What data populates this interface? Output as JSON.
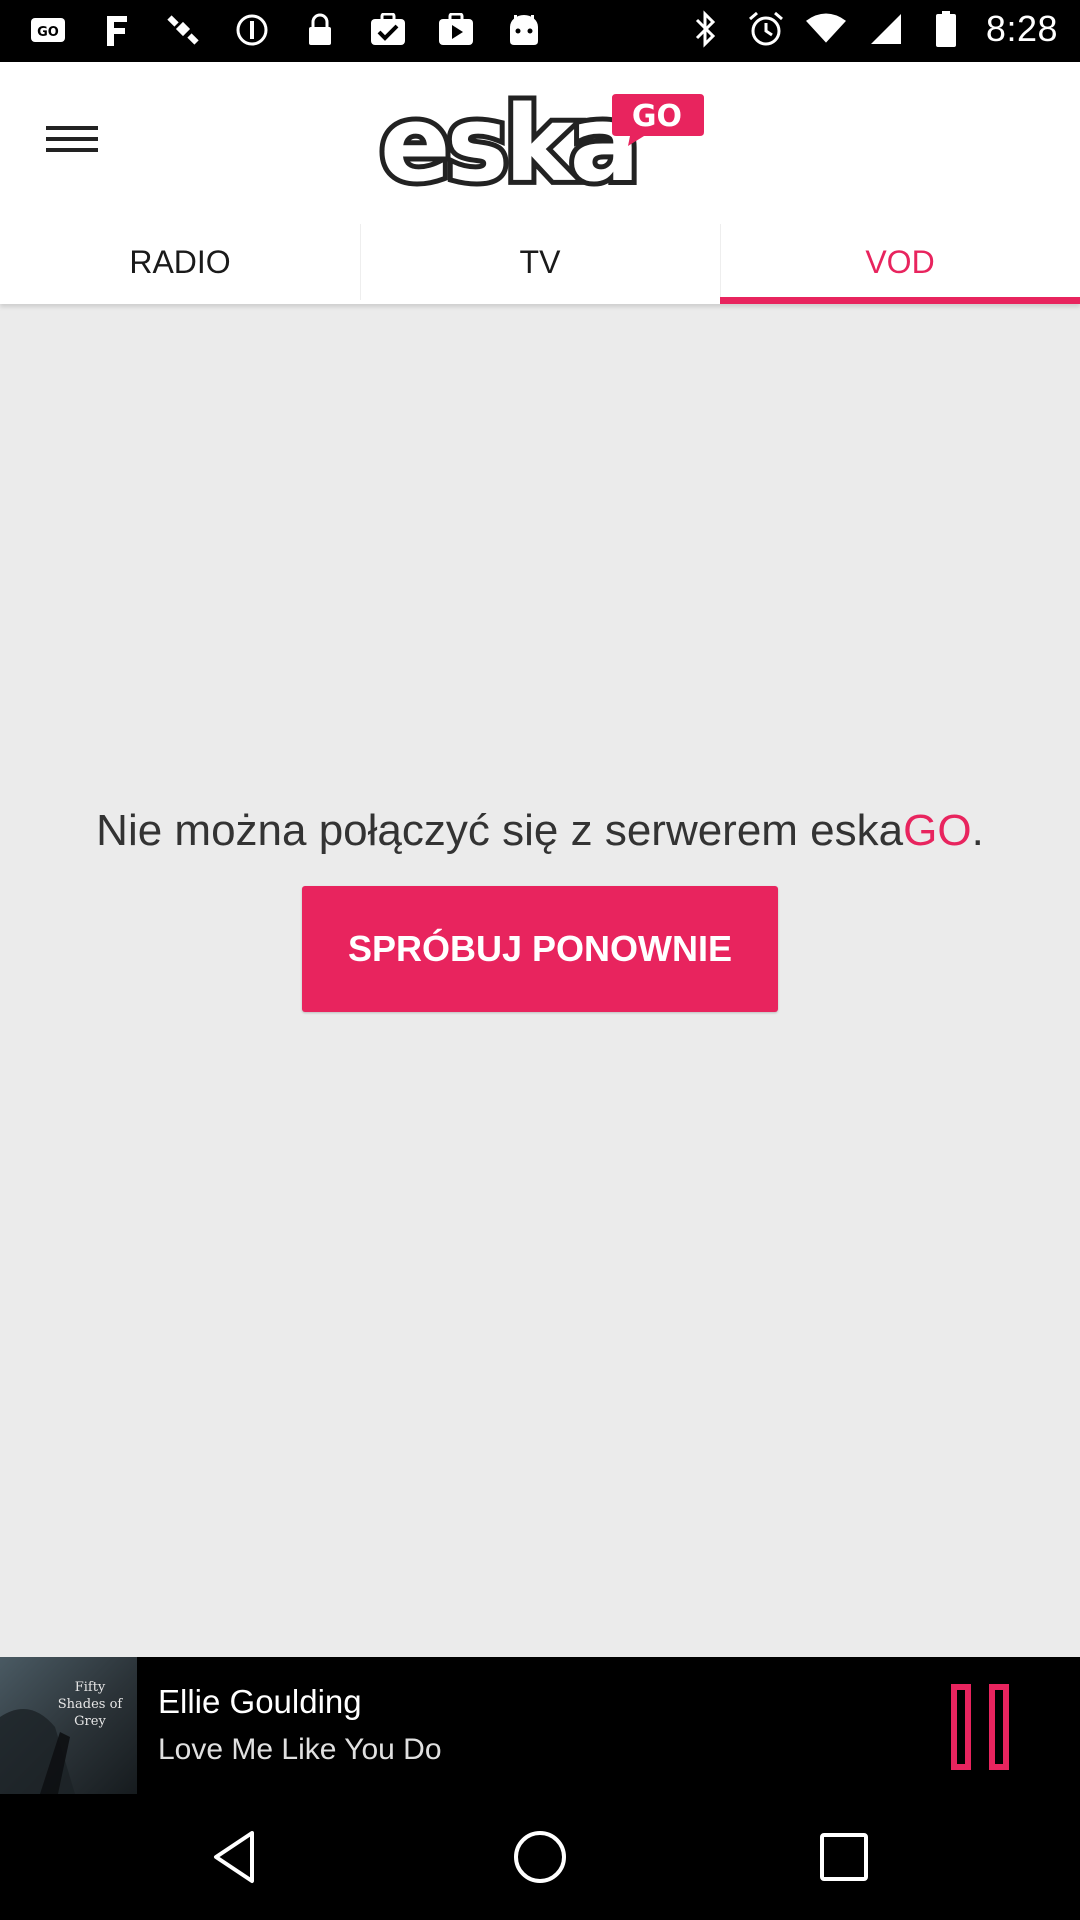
{
  "status_bar": {
    "time": "8:28",
    "left_icons": [
      "eskago-notification-icon",
      "fake-gps-icon",
      "satellite-icon",
      "sync-icon",
      "lock-icon",
      "task-check-icon",
      "play-store-icon",
      "android-icon"
    ],
    "right_icons": [
      "bluetooth-icon",
      "alarm-icon",
      "wifi-icon",
      "signal-icon",
      "battery-icon"
    ]
  },
  "header": {
    "logo_text": "eska",
    "logo_badge": "GO",
    "tabs": [
      {
        "label": "RADIO",
        "active": false
      },
      {
        "label": "TV",
        "active": false
      },
      {
        "label": "VOD",
        "active": true
      }
    ]
  },
  "main": {
    "error_message": "Nie można połączyć się z serwerem eska",
    "error_brand": "GO",
    "error_suffix": ".",
    "retry_label": "SPRÓBUJ PONOWNIE"
  },
  "player": {
    "cover_text": "Fifty Shades of Grey",
    "artist": "Ellie Goulding",
    "track": "Love Me Like You Do",
    "state": "playing"
  },
  "colors": {
    "accent": "#e8245e",
    "background": "#ebebeb",
    "header_bg": "#ffffff",
    "player_bg": "#000000"
  }
}
